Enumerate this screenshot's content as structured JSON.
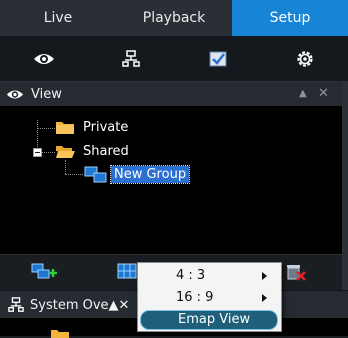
{
  "tabs": [
    {
      "label": "Live",
      "active": false
    },
    {
      "label": "Playback",
      "active": false
    },
    {
      "label": "Setup",
      "active": true
    }
  ],
  "icon_bar": [
    "eye-icon",
    "network-icon",
    "checklist-icon",
    "gear-icon"
  ],
  "view_panel": {
    "title": "View",
    "icon": "eye-icon",
    "tree": {
      "private_label": "Private",
      "shared_label": "Shared",
      "new_group_label": "New Group"
    }
  },
  "toolbar": [
    "add-group-icon",
    "layout-icon",
    "delete-icon"
  ],
  "context_menu": {
    "items": [
      {
        "label": "4 : 3",
        "has_submenu": true
      },
      {
        "label": "16 : 9",
        "has_submenu": true
      },
      {
        "label": "Emap View",
        "highlighted": true
      }
    ]
  },
  "system_panel": {
    "title": "System Ove",
    "icon": "network-icon"
  },
  "colors": {
    "accent": "#1784d6",
    "selection": "#2b6fd1",
    "menu_highlight": "#1f5f7a"
  }
}
